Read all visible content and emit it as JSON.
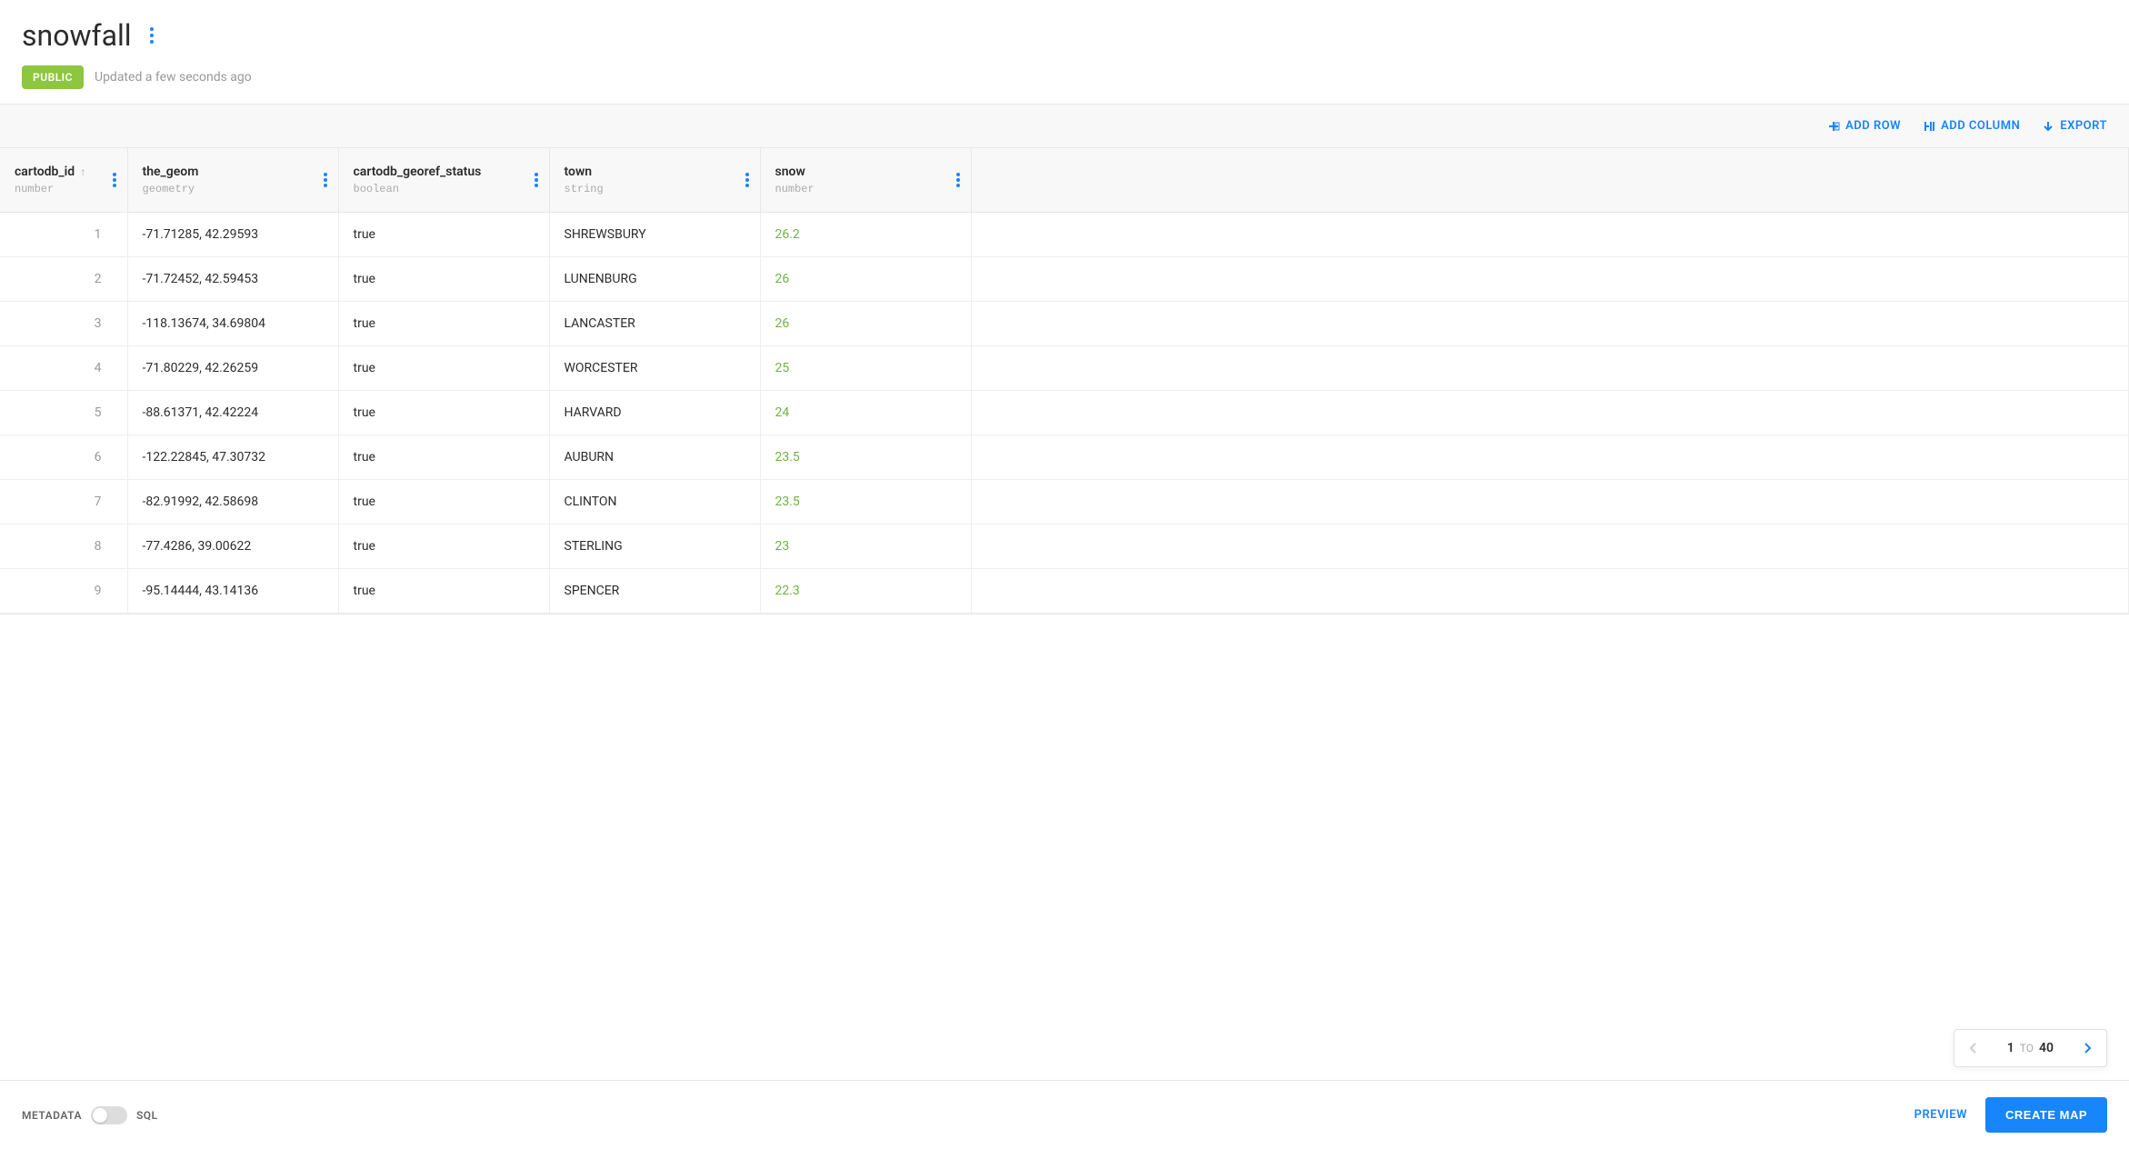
{
  "header": {
    "title": "snowfall",
    "badge": "PUBLIC",
    "updated": "Updated a few seconds ago"
  },
  "toolbar": {
    "add_row": "ADD ROW",
    "add_column": "ADD COLUMN",
    "export": "EXPORT"
  },
  "columns": [
    {
      "name": "cartodb_id",
      "type": "number",
      "sorted_asc": true
    },
    {
      "name": "the_geom",
      "type": "geometry"
    },
    {
      "name": "cartodb_georef_status",
      "type": "boolean"
    },
    {
      "name": "town",
      "type": "string"
    },
    {
      "name": "snow",
      "type": "number"
    }
  ],
  "rows": [
    {
      "id": 1,
      "geom": "-71.71285, 42.29593",
      "georef": "true",
      "town": "SHREWSBURY",
      "snow": "26.2"
    },
    {
      "id": 2,
      "geom": "-71.72452, 42.59453",
      "georef": "true",
      "town": "LUNENBURG",
      "snow": "26"
    },
    {
      "id": 3,
      "geom": "-118.13674, 34.69804",
      "georef": "true",
      "town": "LANCASTER",
      "snow": "26"
    },
    {
      "id": 4,
      "geom": "-71.80229, 42.26259",
      "georef": "true",
      "town": "WORCESTER",
      "snow": "25"
    },
    {
      "id": 5,
      "geom": "-88.61371, 42.42224",
      "georef": "true",
      "town": "HARVARD",
      "snow": "24"
    },
    {
      "id": 6,
      "geom": "-122.22845, 47.30732",
      "georef": "true",
      "town": "AUBURN",
      "snow": "23.5"
    },
    {
      "id": 7,
      "geom": "-82.91992, 42.58698",
      "georef": "true",
      "town": "CLINTON",
      "snow": "23.5"
    },
    {
      "id": 8,
      "geom": "-77.4286, 39.00622",
      "georef": "true",
      "town": "STERLING",
      "snow": "23"
    },
    {
      "id": 9,
      "geom": "-95.14444, 43.14136",
      "georef": "true",
      "town": "SPENCER",
      "snow": "22.3"
    }
  ],
  "paginator": {
    "from": "1",
    "to_label": "TO",
    "to": "40"
  },
  "footer": {
    "toggle_left": "METADATA",
    "toggle_right": "SQL",
    "preview": "PREVIEW",
    "create_map": "CREATE MAP"
  }
}
